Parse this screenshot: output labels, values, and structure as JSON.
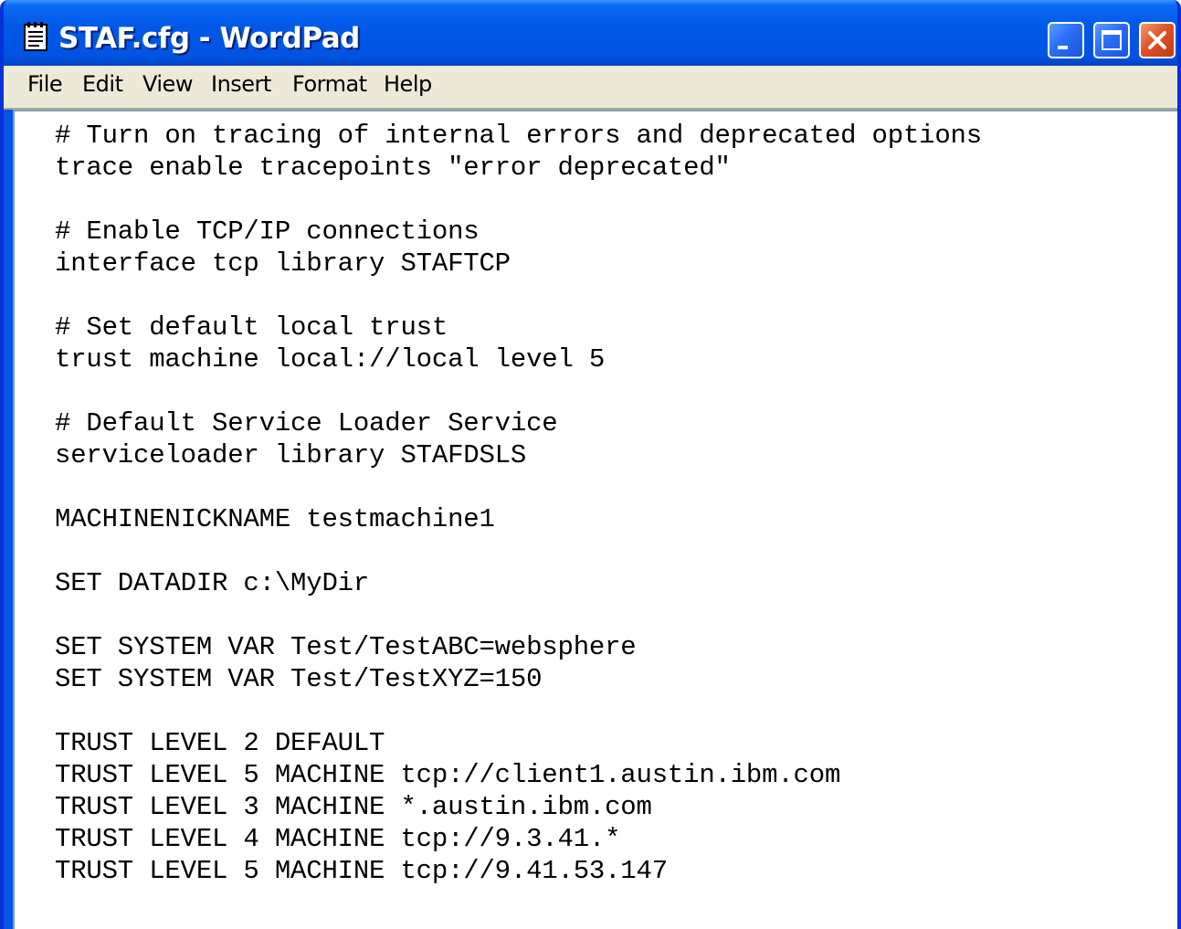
{
  "window": {
    "title": "STAF.cfg - WordPad",
    "accent_color": "#0054e3",
    "icons": [
      "notepad-document-icon",
      "minimize-icon",
      "maximize-icon",
      "close-icon"
    ]
  },
  "menu": {
    "items": [
      "File",
      "Edit",
      "View",
      "Insert",
      "Format",
      "Help"
    ]
  },
  "document": {
    "lines": [
      "# Turn on tracing of internal errors and deprecated options",
      "trace enable tracepoints \"error deprecated\"",
      "",
      "# Enable TCP/IP connections",
      "interface tcp library STAFTCP",
      "",
      "# Set default local trust",
      "trust machine local://local level 5",
      "",
      "# Default Service Loader Service",
      "serviceloader library STAFDSLS",
      "",
      "MACHINENICKNAME testmachine1",
      "",
      "SET DATADIR c:\\MyDir",
      "",
      "SET SYSTEM VAR Test/TestABC=websphere",
      "SET SYSTEM VAR Test/TestXYZ=150",
      "",
      "TRUST LEVEL 2 DEFAULT",
      "TRUST LEVEL 5 MACHINE tcp://client1.austin.ibm.com",
      "TRUST LEVEL 3 MACHINE *.austin.ibm.com",
      "TRUST LEVEL 4 MACHINE tcp://9.3.41.*",
      "TRUST LEVEL 5 MACHINE tcp://9.41.53.147"
    ]
  }
}
